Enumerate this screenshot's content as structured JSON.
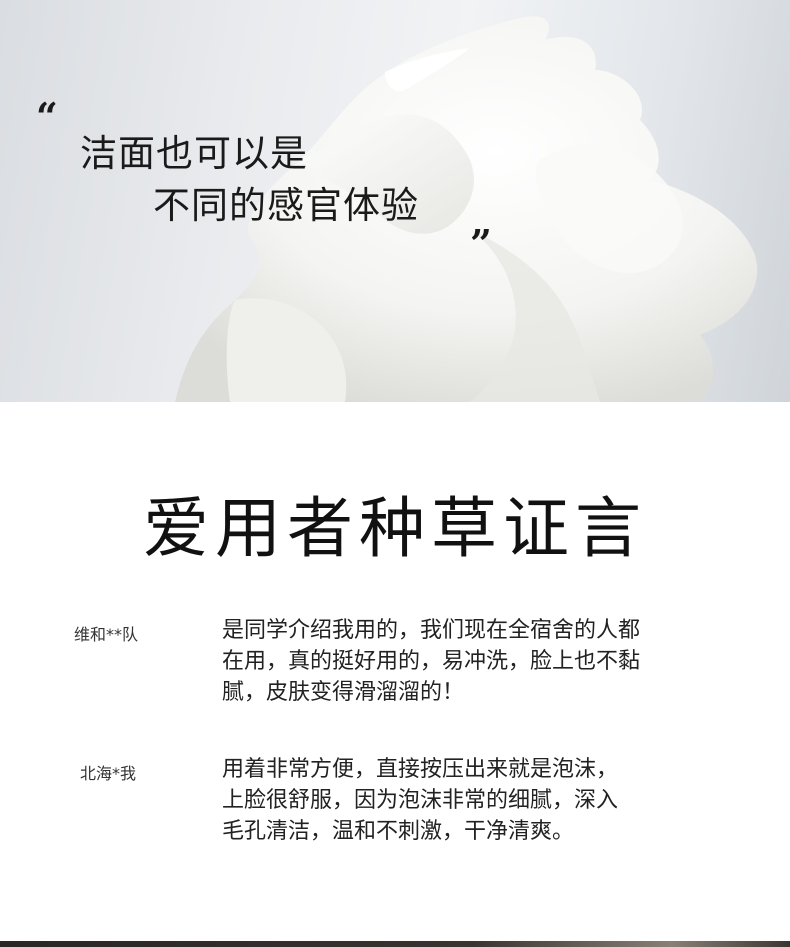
{
  "hero": {
    "quote_open": "“",
    "quote_close": "”",
    "line1": "洁面也可以是",
    "line2": "不同的感官体验",
    "image": "white-foam-photo"
  },
  "section": {
    "title": "爱用者种草证言"
  },
  "testimonials": [
    {
      "reviewer": "维和**队",
      "lines": [
        "是同学介绍我用的，我们现在全宿舍的人都",
        "在用，真的挺好用的，易冲洗，脸上也不黏",
        "腻，皮肤变得滑溜溜的！"
      ]
    },
    {
      "reviewer": "北海*我",
      "lines": [
        "用着非常方便，直接按压出来就是泡沫，",
        "上脸很舒服，因为泡沫非常的细腻，深入",
        "毛孔清洁，温和不刺激，干净清爽。"
      ]
    }
  ],
  "colors": {
    "text": "#1a1a1a",
    "background": "#ffffff",
    "foam": "#f7f7f5"
  }
}
